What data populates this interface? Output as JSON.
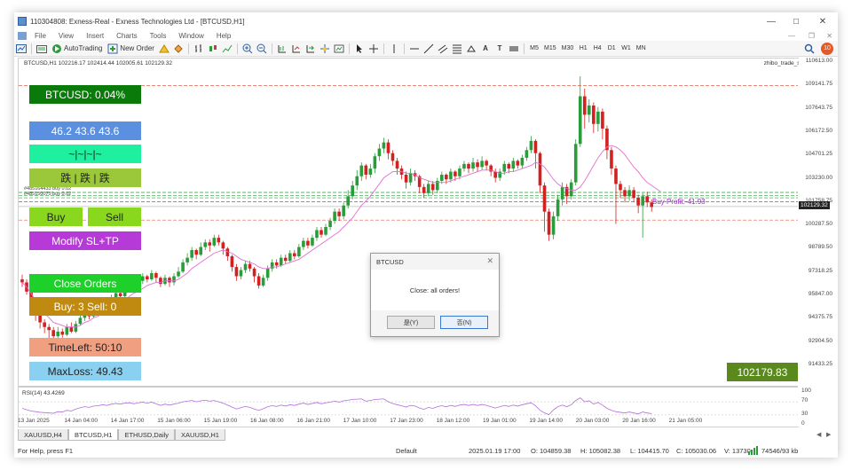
{
  "window": {
    "title": "110304808: Exness-Real - Exness Technologies Ltd - [BTCUSD,H1]"
  },
  "menu": [
    "File",
    "View",
    "Insert",
    "Charts",
    "Tools",
    "Window",
    "Help"
  ],
  "toolbar": {
    "autotrading": "AutoTrading",
    "neworder": "New Order",
    "timeframes": [
      "M5",
      "M15",
      "M30",
      "H1",
      "H4",
      "D1",
      "W1",
      "MN"
    ],
    "notif_count": "10"
  },
  "chart": {
    "header": "BTCUSD,H1  102216.17 102414.44 102005.61 102129.32",
    "script": "zhibo_trade_simple",
    "order_line1": "#485164433 buy 0.02",
    "order_line2": "#485150075 buy 0.02",
    "buy_profit": "Buy Profit:-41.93",
    "current_price": "102129.32",
    "price_labels": [
      "110613.00",
      "109141.75",
      "107643.75",
      "106172.50",
      "104701.25",
      "103230.00",
      "101758.75",
      "100287.50",
      "98789.50",
      "97318.25",
      "95847.00",
      "94375.75",
      "92904.50",
      "91433.25"
    ],
    "time_labels": [
      "13 Jan 2025",
      "14 Jan 04:00",
      "14 Jan 17:00",
      "15 Jan 06:00",
      "15 Jan 19:00",
      "16 Jan 08:00",
      "16 Jan 21:00",
      "17 Jan 10:00",
      "17 Jan 23:00",
      "18 Jan 12:00",
      "19 Jan 01:00",
      "19 Jan 14:00",
      "20 Jan 03:00",
      "20 Jan 16:00",
      "21 Jan 05:00"
    ],
    "rsi_label": "RSI(14) 43.4269",
    "rsi_scale": [
      "100",
      "70",
      "30",
      "0"
    ],
    "price_box": "102179.83"
  },
  "panel": {
    "symbol_change": "BTCUSD: 0.04%",
    "rsi_values": "46.2  43.6  43.6",
    "pattern": "~|~|~|~",
    "trend": "跌 | 跌 | 跌",
    "buy": "Buy",
    "sell": "Sell",
    "modify": "Modify SL+TP",
    "close_orders": "Close Orders",
    "counts": "Buy: 3  Sell: 0",
    "timeleft": "TimeLeft: 50:10",
    "maxloss": "MaxLoss: 49.43"
  },
  "dialog": {
    "title": "BTCUSD",
    "message": "Close: all orders!",
    "yes": "是(Y)",
    "no": "否(N)"
  },
  "tabs": [
    "XAUUSD,H4",
    "BTCUSD,H1",
    "ETHUSD,Daily",
    "XAUUSD,H1"
  ],
  "status": {
    "help": "For Help, press F1",
    "profile": "Default",
    "datetime": "2025.01.19 17:00",
    "open": "O: 104859.38",
    "high": "H: 105082.38",
    "low": "L: 104415.70",
    "close": "C: 105030.06",
    "volume": "V: 13730",
    "traffic": "74546/93 kb"
  },
  "candles": [
    [
      97.4,
      97.2,
      97.7,
      96.9
    ],
    [
      97.2,
      96.6,
      97.4,
      96.4
    ],
    [
      96.6,
      95.8,
      96.8,
      95.4
    ],
    [
      95.8,
      95.1,
      96.0,
      94.7
    ],
    [
      95.1,
      94.6,
      95.4,
      94.2
    ],
    [
      94.6,
      94.3,
      94.8,
      93.9
    ],
    [
      94.3,
      94.1,
      94.5,
      93.4
    ],
    [
      94.1,
      93.7,
      94.3,
      93.1
    ],
    [
      93.7,
      94.0,
      94.3,
      93.5
    ],
    [
      94.0,
      93.8,
      94.2,
      93.6
    ],
    [
      93.8,
      94.3,
      94.5,
      93.7
    ],
    [
      94.3,
      94.0,
      94.6,
      93.9
    ],
    [
      94.0,
      94.5,
      94.7,
      93.9
    ],
    [
      94.5,
      94.9,
      95.1,
      94.4
    ],
    [
      94.9,
      95.2,
      95.4,
      94.7
    ],
    [
      95.2,
      95.0,
      95.3,
      94.8
    ],
    [
      95.0,
      95.4,
      95.6,
      94.9
    ],
    [
      95.4,
      95.5,
      95.7,
      95.2
    ],
    [
      95.5,
      95.9,
      96.1,
      95.4
    ],
    [
      95.9,
      95.7,
      96.0,
      95.5
    ],
    [
      95.7,
      96.2,
      96.4,
      95.6
    ],
    [
      96.2,
      96.5,
      96.7,
      96.0
    ],
    [
      96.5,
      96.3,
      96.6,
      96.1
    ],
    [
      96.3,
      96.8,
      97.0,
      96.2
    ],
    [
      96.8,
      97.1,
      97.3,
      96.6
    ],
    [
      97.1,
      96.9,
      97.2,
      96.7
    ],
    [
      96.9,
      97.3,
      97.5,
      96.8
    ],
    [
      97.3,
      97.6,
      97.8,
      97.1
    ],
    [
      97.6,
      97.4,
      97.7,
      97.2
    ],
    [
      97.4,
      97.8,
      98.0,
      97.3
    ],
    [
      97.8,
      97.5,
      97.9,
      97.2
    ],
    [
      97.5,
      97.1,
      97.6,
      96.9
    ],
    [
      97.1,
      97.5,
      97.7,
      97.0
    ],
    [
      97.5,
      97.2,
      97.6,
      96.9
    ],
    [
      97.2,
      97.6,
      97.8,
      97.0
    ],
    [
      97.6,
      97.9,
      98.2,
      97.5
    ],
    [
      97.9,
      98.5,
      98.7,
      97.8
    ],
    [
      98.5,
      98.8,
      99.1,
      98.3
    ],
    [
      98.8,
      99.3,
      99.5,
      98.6
    ],
    [
      99.3,
      99.0,
      99.4,
      98.7
    ],
    [
      99.0,
      99.5,
      99.8,
      98.9
    ],
    [
      99.5,
      99.8,
      100.0,
      99.3
    ],
    [
      99.8,
      99.6,
      100.0,
      99.2
    ],
    [
      99.6,
      100.1,
      100.3,
      99.5
    ],
    [
      100.1,
      99.8,
      100.3,
      99.6
    ],
    [
      99.8,
      99.4,
      99.9,
      99.0
    ],
    [
      99.4,
      98.9,
      99.5,
      98.6
    ],
    [
      98.9,
      98.2,
      99.0,
      97.9
    ],
    [
      98.2,
      97.6,
      98.4,
      97.3
    ],
    [
      97.6,
      98.0,
      98.2,
      97.4
    ],
    [
      98.0,
      98.4,
      98.6,
      97.8
    ],
    [
      98.4,
      98.1,
      98.6,
      97.9
    ],
    [
      98.1,
      97.6,
      98.2,
      97.2
    ],
    [
      97.6,
      97.0,
      97.8,
      96.8
    ],
    [
      97.0,
      97.5,
      97.7,
      96.9
    ],
    [
      97.5,
      98.1,
      98.3,
      97.3
    ],
    [
      98.1,
      98.5,
      98.7,
      97.9
    ],
    [
      98.5,
      98.3,
      98.7,
      98.1
    ],
    [
      98.3,
      98.8,
      99.0,
      98.2
    ],
    [
      98.8,
      98.6,
      99.0,
      98.4
    ],
    [
      98.6,
      99.1,
      99.3,
      98.5
    ],
    [
      99.1,
      98.9,
      99.3,
      98.7
    ],
    [
      98.9,
      99.5,
      99.7,
      98.8
    ],
    [
      99.5,
      99.9,
      100.1,
      99.3
    ],
    [
      99.9,
      99.6,
      100.1,
      99.4
    ],
    [
      99.6,
      100.1,
      100.3,
      99.5
    ],
    [
      100.1,
      100.6,
      100.8,
      99.9
    ],
    [
      100.6,
      100.3,
      100.8,
      100.1
    ],
    [
      100.3,
      100.8,
      101.0,
      100.2
    ],
    [
      100.8,
      101.2,
      101.4,
      100.6
    ],
    [
      101.2,
      101.8,
      102.0,
      101.0
    ],
    [
      101.8,
      101.5,
      102.0,
      101.2
    ],
    [
      101.5,
      102.2,
      102.4,
      101.3
    ],
    [
      102.2,
      102.8,
      103.2,
      102.0
    ],
    [
      102.8,
      103.5,
      103.8,
      102.6
    ],
    [
      103.5,
      104.1,
      104.5,
      103.2
    ],
    [
      104.1,
      104.8,
      105.0,
      103.8
    ],
    [
      104.8,
      104.2,
      104.9,
      103.9
    ],
    [
      104.2,
      104.6,
      104.9,
      104.0
    ],
    [
      104.6,
      105.4,
      105.6,
      104.3
    ],
    [
      105.4,
      105.9,
      106.2,
      105.1
    ],
    [
      105.9,
      106.3,
      106.6,
      105.6
    ],
    [
      106.3,
      105.6,
      106.5,
      105.2
    ],
    [
      105.6,
      105.1,
      105.8,
      104.8
    ],
    [
      105.1,
      104.6,
      105.3,
      104.2
    ],
    [
      104.6,
      104.2,
      104.8,
      103.9
    ],
    [
      104.2,
      103.7,
      104.4,
      103.3
    ],
    [
      103.7,
      104.3,
      104.6,
      103.5
    ],
    [
      104.3,
      104.1,
      104.5,
      103.8
    ],
    [
      104.1,
      103.4,
      104.2,
      103.0
    ],
    [
      103.4,
      103.0,
      103.6,
      102.7
    ],
    [
      103.0,
      103.6,
      103.8,
      102.8
    ],
    [
      103.6,
      103.2,
      103.8,
      102.9
    ],
    [
      103.2,
      103.8,
      104.0,
      103.0
    ],
    [
      103.8,
      104.2,
      104.4,
      103.6
    ],
    [
      104.2,
      103.9,
      104.3,
      103.6
    ],
    [
      103.9,
      104.4,
      104.6,
      103.7
    ],
    [
      104.4,
      104.1,
      104.5,
      103.8
    ],
    [
      104.1,
      104.6,
      104.8,
      103.9
    ],
    [
      104.6,
      104.9,
      105.1,
      104.4
    ],
    [
      104.9,
      104.6,
      105.0,
      104.3
    ],
    [
      104.6,
      105.0,
      105.3,
      104.4
    ],
    [
      105.0,
      104.7,
      105.2,
      104.4
    ],
    [
      104.7,
      105.1,
      105.4,
      104.5
    ],
    [
      105.1,
      104.8,
      105.2,
      104.5
    ],
    [
      104.8,
      104.4,
      104.9,
      104.1
    ],
    [
      104.4,
      104.0,
      104.6,
      103.7
    ],
    [
      104.0,
      104.4,
      104.6,
      103.8
    ],
    [
      104.4,
      104.9,
      105.1,
      104.2
    ],
    [
      104.9,
      104.6,
      105.0,
      104.3
    ],
    [
      104.6,
      105.1,
      105.3,
      104.4
    ],
    [
      105.1,
      104.8,
      105.2,
      104.6
    ],
    [
      104.8,
      105.3,
      105.5,
      104.6
    ],
    [
      105.3,
      105.8,
      106.0,
      105.1
    ],
    [
      105.8,
      106.4,
      106.7,
      105.6
    ],
    [
      106.4,
      105.6,
      106.5,
      104.6
    ],
    [
      105.6,
      103.5,
      105.7,
      103.0
    ],
    [
      103.5,
      101.8,
      103.7,
      100.5
    ],
    [
      101.8,
      100.3,
      102.0,
      99.9
    ],
    [
      100.3,
      101.5,
      101.8,
      100.0
    ],
    [
      101.5,
      102.6,
      102.9,
      101.2
    ],
    [
      102.6,
      103.4,
      103.7,
      102.2
    ],
    [
      103.4,
      102.8,
      103.6,
      102.3
    ],
    [
      102.8,
      103.7,
      103.9,
      102.6
    ],
    [
      103.7,
      106.2,
      106.5,
      103.5
    ],
    [
      106.2,
      109.3,
      110.6,
      106.0
    ],
    [
      109.3,
      108.1,
      109.8,
      107.2
    ],
    [
      108.1,
      108.7,
      109.1,
      107.6
    ],
    [
      108.7,
      107.5,
      108.9,
      106.9
    ],
    [
      107.5,
      108.3,
      108.6,
      107.0
    ],
    [
      108.3,
      107.2,
      108.5,
      106.5
    ],
    [
      107.2,
      105.8,
      107.4,
      105.2
    ],
    [
      105.8,
      104.6,
      106.0,
      104.2
    ],
    [
      104.6,
      103.6,
      104.8,
      101.0
    ],
    [
      103.6,
      103.2,
      103.8,
      102.7
    ],
    [
      103.2,
      102.8,
      103.4,
      102.4
    ],
    [
      102.8,
      103.2,
      103.5,
      102.5
    ],
    [
      103.2,
      102.7,
      103.4,
      102.4
    ],
    [
      102.7,
      102.2,
      102.9,
      101.7
    ],
    [
      102.2,
      102.8,
      103.0,
      100.1
    ],
    [
      102.8,
      102.4,
      103.1,
      102.1
    ],
    [
      102.4,
      102.1,
      102.6,
      101.8
    ]
  ],
  "ma": [
    97.2,
    96.9,
    96.5,
    96.0,
    95.6,
    95.2,
    94.9,
    94.6,
    94.5,
    94.4,
    94.3,
    94.3,
    94.3,
    94.4,
    94.6,
    94.7,
    94.9,
    95.0,
    95.2,
    95.3,
    95.5,
    95.7,
    95.9,
    96.0,
    96.3,
    96.5,
    96.6,
    96.8,
    97.0,
    97.1,
    97.2,
    97.2,
    97.3,
    97.3,
    97.3,
    97.4,
    97.6,
    97.8,
    98.1,
    98.3,
    98.5,
    98.7,
    98.9,
    99.1,
    99.2,
    99.3,
    99.2,
    99.1,
    98.9,
    98.7,
    98.6,
    98.5,
    98.4,
    98.2,
    98.1,
    98.1,
    98.2,
    98.2,
    98.3,
    98.4,
    98.5,
    98.6,
    98.7,
    98.9,
    99.1,
    99.3,
    99.5,
    99.7,
    99.9,
    100.1,
    100.3,
    100.5,
    100.8,
    101.1,
    101.4,
    101.8,
    102.2,
    102.5,
    102.8,
    103.2,
    103.6,
    104.0,
    104.2,
    104.4,
    104.4,
    104.4,
    104.3,
    104.3,
    104.2,
    104.0,
    103.9,
    103.8,
    103.7,
    103.7,
    103.7,
    103.7,
    103.8,
    103.9,
    104.0,
    104.1,
    104.2,
    104.3,
    104.4,
    104.5,
    104.5,
    104.5,
    104.4,
    104.3,
    104.3,
    104.4,
    104.4,
    104.5,
    104.6,
    104.7,
    104.8,
    105.0,
    104.9,
    104.7,
    104.3,
    103.9,
    103.6,
    103.4,
    103.3,
    103.2,
    103.2,
    103.4,
    103.8,
    104.3,
    104.8,
    105.3,
    105.7,
    106.0,
    106.1,
    106.0,
    105.8,
    105.5,
    105.1,
    104.7,
    104.4,
    104.0,
    103.7,
    103.5,
    103.3,
    103.1
  ],
  "rsi": [
    50,
    46,
    42,
    40,
    38,
    37,
    36,
    35,
    40,
    39,
    44,
    42,
    48,
    52,
    55,
    53,
    57,
    58,
    61,
    59,
    63,
    65,
    63,
    66,
    67,
    64,
    67,
    69,
    66,
    69,
    64,
    59,
    63,
    60,
    63,
    66,
    70,
    72,
    74,
    70,
    73,
    75,
    72,
    74,
    70,
    66,
    60,
    54,
    48,
    52,
    56,
    53,
    48,
    44,
    49,
    55,
    58,
    56,
    60,
    57,
    61,
    59,
    63,
    66,
    62,
    65,
    68,
    64,
    67,
    69,
    72,
    69,
    73,
    75,
    77,
    78,
    79,
    72,
    74,
    77,
    78,
    79,
    70,
    65,
    61,
    58,
    54,
    59,
    57,
    51,
    47,
    53,
    50,
    55,
    58,
    55,
    59,
    56,
    60,
    62,
    59,
    62,
    59,
    62,
    59,
    55,
    51,
    55,
    59,
    56,
    60,
    57,
    61,
    64,
    67,
    58,
    44,
    36,
    31,
    45,
    55,
    60,
    55,
    61,
    74,
    82,
    70,
    73,
    63,
    68,
    60,
    50,
    44,
    40,
    38,
    36,
    39,
    36,
    33,
    39,
    36,
    34
  ]
}
